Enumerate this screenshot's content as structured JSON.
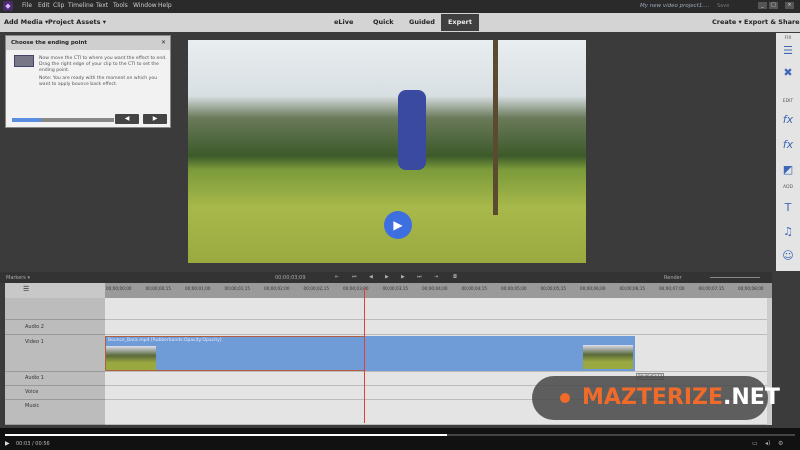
{
  "titlebar": {
    "menus": [
      "File",
      "Edit",
      "Clip",
      "Timeline",
      "Text",
      "Tools",
      "Window",
      "Help"
    ],
    "project": "My new video project1....",
    "save": "Save"
  },
  "toolbar": {
    "add_media": "Add Media ▾",
    "project_assets": "Project Assets ▾",
    "modes": [
      "eLive",
      "Quick",
      "Guided",
      "Expert"
    ],
    "create": "Create ▾",
    "export": "Export & Share"
  },
  "panel": {
    "title": "Choose the ending point",
    "text1": "Now move the CTI to where you want the effect to end. Drag the right edge of your clip to the CTI to set the ending point.",
    "text2": "Note: You are ready with the moment on which you want to apply bounce back effect.",
    "progress": 0.28,
    "prev": "◀",
    "next": "▶"
  },
  "sidebar": {
    "fix": "FIX",
    "edit": "EDIT",
    "add": "ADD"
  },
  "timeline": {
    "markers": "Markers ▾",
    "current": "00;00;03;09",
    "render": "Render",
    "ticks": [
      "00;00;00;00",
      "00;00;00;15",
      "00;00;01;00",
      "00;00;01;15",
      "00;00;02;00",
      "00;00;02;15",
      "00;00;03;00",
      "00;00;03;15",
      "00;00;04;00",
      "00;00;04;15",
      "00;00;05;00",
      "00;00;05;15",
      "00;00;06;00",
      "00;00;06;15",
      "00;00;07;00",
      "00;00;07;15",
      "00;00;08;00"
    ],
    "tracks": [
      "Audio 2",
      "Video 1",
      "Audio 1",
      "Voice",
      "Music"
    ],
    "clip_title": "Bounce_Back.mp4 [Rubberbands:Opacity:Opacity]",
    "tooltip": "00;00;03;12"
  },
  "watermark": {
    "brand": "MAZTERIZE",
    ".net": ".NET"
  },
  "player": {
    "time": "00:03 / 00:56",
    "progress": 0.56
  }
}
